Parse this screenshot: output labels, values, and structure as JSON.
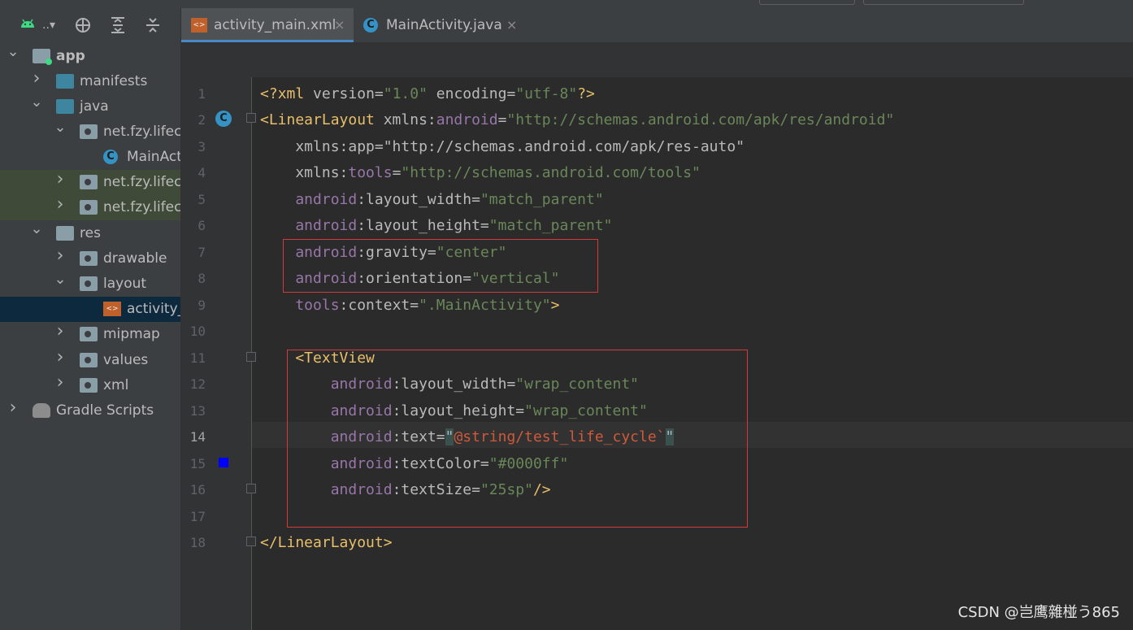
{
  "sidebar": {
    "toolbar": {
      "project_label": "..",
      "dropdown_glyph": "▾"
    },
    "tree": [
      {
        "label": "app",
        "depth": 0,
        "arrow": "down",
        "icon": "module"
      },
      {
        "label": "manifests",
        "depth": 1,
        "arrow": "right",
        "icon": "folder-blue"
      },
      {
        "label": "java",
        "depth": 1,
        "arrow": "down",
        "icon": "folder-blue"
      },
      {
        "label": "net.fzy.lifecy",
        "depth": 2,
        "arrow": "down",
        "icon": "package"
      },
      {
        "label": "MainAct",
        "depth": 3,
        "arrow": "",
        "icon": "class"
      },
      {
        "label": "net.fzy.lifecy",
        "depth": 2,
        "arrow": "right",
        "icon": "package"
      },
      {
        "label": "net.fzy.lifecy",
        "depth": 2,
        "arrow": "right",
        "icon": "package"
      },
      {
        "label": "res",
        "depth": 1,
        "arrow": "down",
        "icon": "res"
      },
      {
        "label": "drawable",
        "depth": 2,
        "arrow": "right",
        "icon": "folder"
      },
      {
        "label": "layout",
        "depth": 2,
        "arrow": "down",
        "icon": "folder"
      },
      {
        "label": "activity_",
        "depth": 3,
        "arrow": "",
        "icon": "xml"
      },
      {
        "label": "mipmap",
        "depth": 2,
        "arrow": "right",
        "icon": "folder"
      },
      {
        "label": "values",
        "depth": 2,
        "arrow": "right",
        "icon": "folder"
      },
      {
        "label": "xml",
        "depth": 2,
        "arrow": "right",
        "icon": "folder"
      },
      {
        "label": "Gradle Scripts",
        "depth": 0,
        "arrow": "right",
        "icon": "gradle"
      }
    ]
  },
  "tabs": [
    {
      "label": "activity_main.xml",
      "active": true,
      "icon": "xml-file-icon",
      "close": "×"
    },
    {
      "label": "MainActivity.java",
      "active": false,
      "icon": "java-class-icon",
      "close": "×"
    }
  ],
  "editor": {
    "line_numbers": [
      "1",
      "2",
      "3",
      "4",
      "5",
      "6",
      "7",
      "8",
      "9",
      "10",
      "11",
      "12",
      "13",
      "14",
      "15",
      "16",
      "17",
      "18"
    ],
    "current_line": "14",
    "lines": [
      [
        [
          "pi",
          "<?"
        ],
        [
          "pi",
          "xml "
        ],
        [
          "attr",
          "version"
        ],
        [
          "attr",
          "="
        ],
        [
          "val",
          "\"1.0\""
        ],
        [
          "attr",
          " encoding"
        ],
        [
          "attr",
          "="
        ],
        [
          "val",
          "\"utf-8\""
        ],
        [
          "pi",
          "?>"
        ]
      ],
      [
        [
          "tag",
          "<LinearLayout "
        ],
        [
          "attr",
          "xmlns:"
        ],
        [
          "ns",
          "android"
        ],
        [
          "attr",
          "="
        ],
        [
          "val",
          "\"http://schemas.android.com/apk/res/android\""
        ]
      ],
      [
        [
          "attr",
          "    xmlns:app=\"http://schemas.android.com/apk/res-auto\""
        ]
      ],
      [
        [
          "attr",
          "    xmlns:"
        ],
        [
          "ns",
          "tools"
        ],
        [
          "attr",
          "="
        ],
        [
          "val",
          "\"http://schemas.android.com/tools\""
        ]
      ],
      [
        [
          "ns",
          "    android"
        ],
        [
          "attr",
          ":layout_width="
        ],
        [
          "val",
          "\"match_parent\""
        ]
      ],
      [
        [
          "ns",
          "    android"
        ],
        [
          "attr",
          ":layout_height="
        ],
        [
          "val",
          "\"match_parent\""
        ]
      ],
      [
        [
          "ns",
          "    android"
        ],
        [
          "attr",
          ":gravity="
        ],
        [
          "val",
          "\"center\""
        ]
      ],
      [
        [
          "ns",
          "    android"
        ],
        [
          "attr",
          ":orientation="
        ],
        [
          "val",
          "\"vertical\""
        ]
      ],
      [
        [
          "ns",
          "    tools"
        ],
        [
          "attr",
          ":context="
        ],
        [
          "val",
          "\".MainActivity\""
        ],
        [
          "tag",
          ">"
        ]
      ],
      [
        [
          "attr",
          ""
        ]
      ],
      [
        [
          "tag",
          "    <TextView"
        ]
      ],
      [
        [
          "ns",
          "        android"
        ],
        [
          "attr",
          ":layout_width="
        ],
        [
          "val",
          "\"wrap_content\""
        ]
      ],
      [
        [
          "ns",
          "        android"
        ],
        [
          "attr",
          ":layout_height="
        ],
        [
          "val",
          "\"wrap_content\""
        ]
      ],
      [
        [
          "ns",
          "        android"
        ],
        [
          "attr",
          ":text="
        ],
        [
          "hl-bracket",
          "\""
        ],
        [
          "str-err",
          "@string/test_life_cycle`"
        ],
        [
          "hl-bracket",
          "\""
        ]
      ],
      [
        [
          "ns",
          "        android"
        ],
        [
          "attr",
          ":textColor="
        ],
        [
          "val",
          "\"#0000ff\""
        ]
      ],
      [
        [
          "ns",
          "        android"
        ],
        [
          "attr",
          ":textSize="
        ],
        [
          "val",
          "\"25sp\""
        ],
        [
          "tag",
          "/>"
        ]
      ],
      [
        [
          "attr",
          ""
        ]
      ],
      [
        [
          "tag",
          "</LinearLayout>"
        ]
      ]
    ],
    "gutter_color_swatch": "#0000ff"
  },
  "watermark": "CSDN @岂鹰雜椪う865"
}
